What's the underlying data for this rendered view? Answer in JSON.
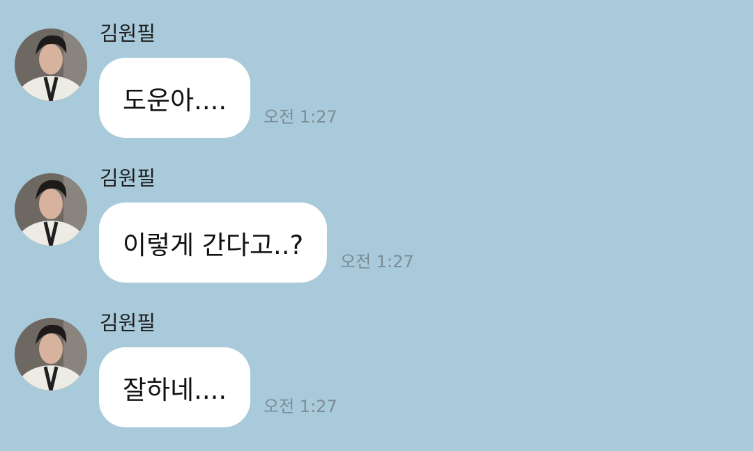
{
  "colors": {
    "background": "#a9cadb",
    "bubble": "#ffffff",
    "time_text": "#7d8c95"
  },
  "messages": [
    {
      "sender": "김원필",
      "text": "도운아....",
      "time": "오전 1:27",
      "avatar_icon": "profile-photo"
    },
    {
      "sender": "김원필",
      "text": "이렇게 간다고..?",
      "time": "오전 1:27",
      "avatar_icon": "profile-photo"
    },
    {
      "sender": "김원필",
      "text": "잘하네....",
      "time": "오전 1:27",
      "avatar_icon": "profile-photo"
    }
  ]
}
